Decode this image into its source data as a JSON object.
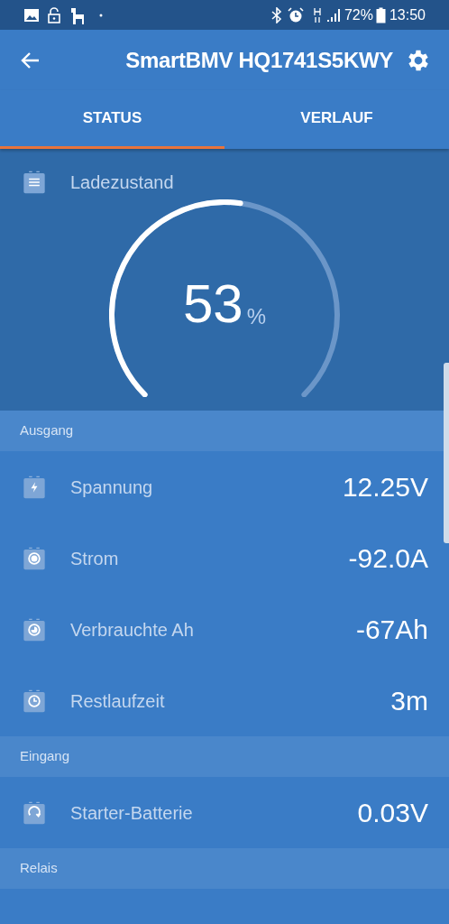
{
  "status_bar": {
    "battery": "72%",
    "time": "13:50"
  },
  "app_bar": {
    "title": "SmartBMV HQ1741S5KWY"
  },
  "tabs": [
    {
      "label": "STATUS",
      "selected": true
    },
    {
      "label": "VERLAUF",
      "selected": false
    }
  ],
  "gauge": {
    "label": "Ladezustand",
    "value": "53",
    "unit": "%"
  },
  "sections": [
    {
      "title": "Ausgang",
      "rows": [
        {
          "kind": "bolt",
          "label": "Spannung",
          "value": "12.25V"
        },
        {
          "kind": "dot",
          "label": "Strom",
          "value": "-92.0A"
        },
        {
          "kind": "pie",
          "label": "Verbrauchte Ah",
          "value": "-67Ah"
        },
        {
          "kind": "clock",
          "label": "Restlaufzeit",
          "value": "3m"
        }
      ]
    },
    {
      "title": "Eingang",
      "rows": [
        {
          "kind": "cycle",
          "label": "Starter-Batterie",
          "value": "0.03V"
        }
      ]
    },
    {
      "title": "Relais"
    }
  ]
}
